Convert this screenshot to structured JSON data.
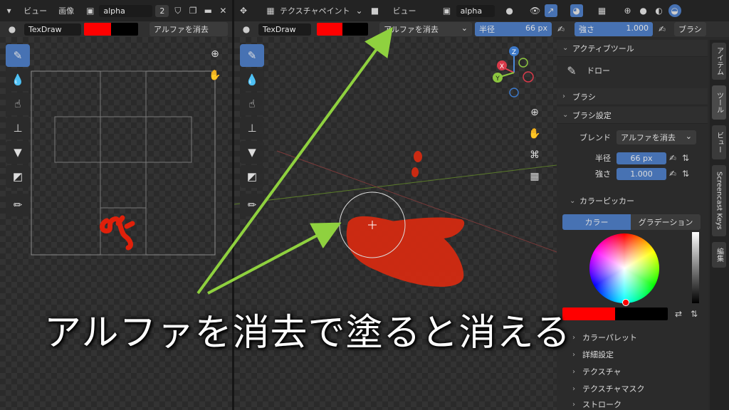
{
  "left_editor": {
    "header": {
      "view_menu": "ビュー",
      "image_menu": "画像",
      "image_name": "alpha",
      "user_count": "2"
    },
    "tool_settings": {
      "brush_name": "TexDraw",
      "blend": "アルファを消去"
    },
    "tools": [
      "brush-icon",
      "drop-icon",
      "smear-icon",
      "stamp-icon",
      "fill-icon",
      "mask-icon",
      "annotate-icon"
    ]
  },
  "right_editor": {
    "header": {
      "mode": "テクスチャペイント",
      "view_menu": "ビュー",
      "image_name": "alpha"
    },
    "tool_settings": {
      "brush_name": "TexDraw",
      "blend": "アルファを消去",
      "radius_label": "半径",
      "radius_value": "66 px",
      "strength_label": "強さ",
      "strength_value": "1.000",
      "brush_menu": "ブラシ"
    },
    "gizmo": {
      "x": "X",
      "y": "Y",
      "z": "Z"
    }
  },
  "n_panel": {
    "active_tool_header": "アクティブツール",
    "active_tool_name": "ドロー",
    "brush_header": "ブラシ",
    "brush_settings_header": "ブラシ設定",
    "blend_label": "ブレンド",
    "blend_value": "アルファを消去",
    "radius_label": "半径",
    "radius_value": "66 px",
    "strength_label": "強さ",
    "strength_value": "1.000",
    "color_picker_header": "カラーピッカー",
    "tab_color": "カラー",
    "tab_gradient": "グラデーション",
    "color_palette": "カラーパレット",
    "advanced": "詳細設定",
    "texture": "テクスチャ",
    "texture_mask": "テクスチャマスク",
    "stroke": "ストローク",
    "primary_color": "#ff0000",
    "secondary_color": "#000000"
  },
  "side_tabs": [
    "アイテム",
    "ツール",
    "ビュー",
    "Screencast Keys",
    "編集"
  ],
  "caption": "アルファを消去で塗ると消える",
  "colors": {
    "accent": "#4772b3",
    "arrow": "#8fd13f",
    "paint": "#e0200a"
  }
}
